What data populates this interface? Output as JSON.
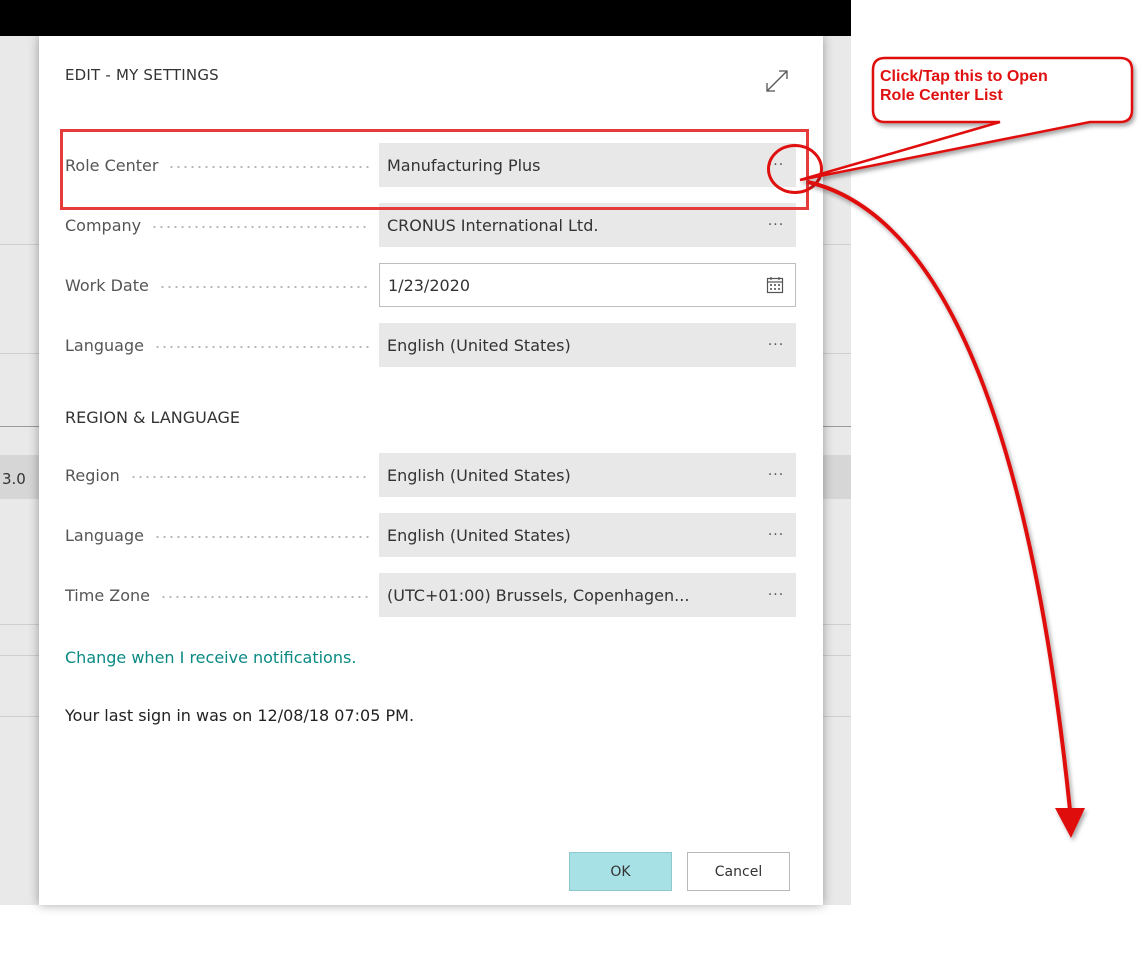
{
  "dialog": {
    "title": "EDIT - MY SETTINGS"
  },
  "background": {
    "partial_text": "3.0"
  },
  "fields": [
    {
      "label": "Role Center",
      "value": "Manufacturing Plus",
      "control": "lookup"
    },
    {
      "label": "Company",
      "value": "CRONUS International Ltd.",
      "control": "lookup"
    },
    {
      "label": "Work Date",
      "value": "1/23/2020",
      "control": "date"
    },
    {
      "label": "Language",
      "value": "English (United States)",
      "control": "lookup"
    }
  ],
  "region_section": {
    "heading": "REGION & LANGUAGE",
    "fields": [
      {
        "label": "Region",
        "value": "English (United States)"
      },
      {
        "label": "Language",
        "value": "English (United States)"
      },
      {
        "label": "Time Zone",
        "value": "(UTC+01:00) Brussels, Copenhagen..."
      }
    ]
  },
  "ellipsis": "···",
  "notifications_link": "Change when I receive notifications.",
  "last_sign_in": "Your last sign in was on 12/08/18 07:05 PM.",
  "buttons": {
    "ok": "OK",
    "cancel": "Cancel"
  },
  "annotation": {
    "line1": "Click/Tap this to Open",
    "line2": "Role Center List",
    "color": "#e01010"
  },
  "icons": {
    "expand": "expand-icon",
    "calendar": "calendar-icon",
    "more": "ellipsis-icon"
  }
}
